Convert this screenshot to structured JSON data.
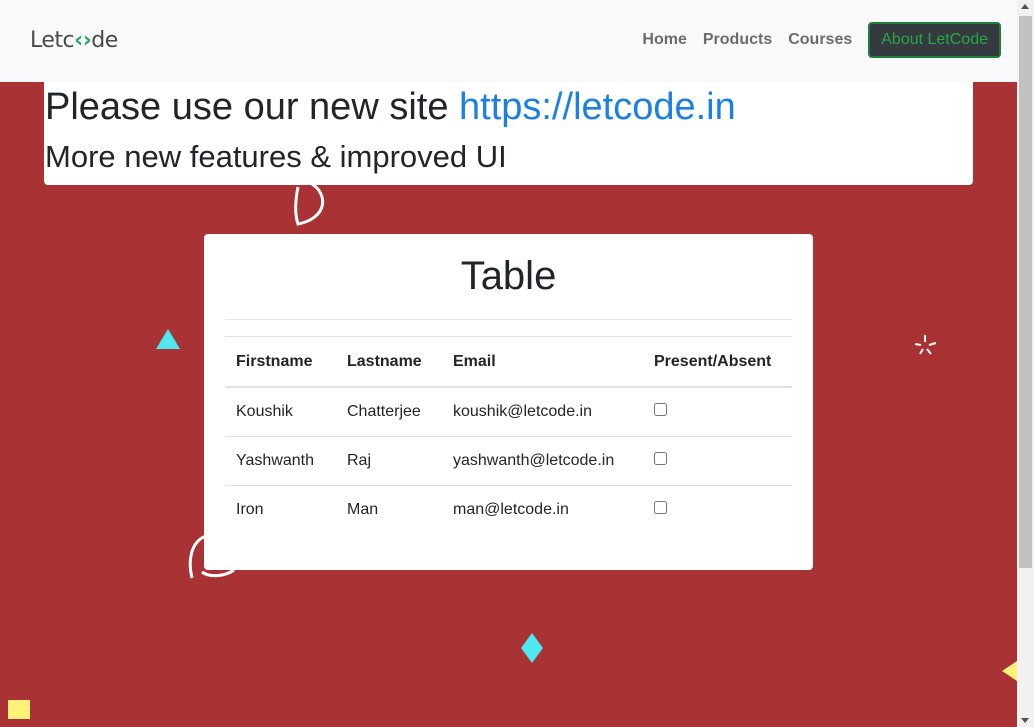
{
  "navbar": {
    "logo_prefix": "Let",
    "logo_mid": "c",
    "logo_mark": "‹›",
    "logo_suffix": "de",
    "links": [
      "Home",
      "Products",
      "Courses"
    ],
    "about_button": "About LetCode"
  },
  "notice": {
    "headline_prefix": "Please use our new site ",
    "headline_link": "https://letcode.in",
    "subheadline": "More new features & improved UI"
  },
  "card": {
    "title": "Table",
    "columns": [
      "Firstname",
      "Lastname",
      "Email",
      "Present/Absent"
    ],
    "rows": [
      {
        "firstname": "Koushik",
        "lastname": "Chatterjee",
        "email": "koushik@letcode.in",
        "present": false
      },
      {
        "firstname": "Yashwanth",
        "lastname": "Raj",
        "email": "yashwanth@letcode.in",
        "present": false
      },
      {
        "firstname": "Iron",
        "lastname": "Man",
        "email": "man@letcode.in",
        "present": false
      }
    ]
  },
  "colors": {
    "background": "#a83234",
    "accent_green": "#28a745",
    "link_blue": "#1a7fe6",
    "confetti_cyan": "#4fe8f0",
    "confetti_yellow": "#fff27a"
  }
}
